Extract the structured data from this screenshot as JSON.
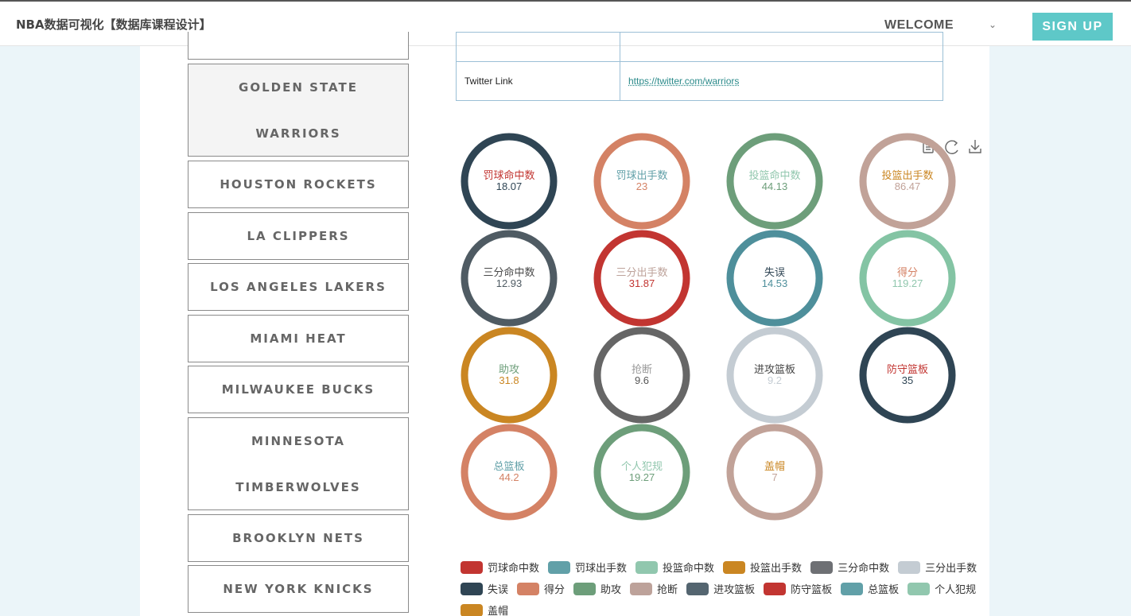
{
  "header": {
    "app_title": "NBA数据可视化【数据库课程设计】",
    "welcome_label": "WELCOME",
    "signup_label": "SIGN UP"
  },
  "teams": [
    {
      "name": "GOLDEN STATE WARRIORS",
      "active": true
    },
    {
      "name": "HOUSTON ROCKETS"
    },
    {
      "name": "LA CLIPPERS"
    },
    {
      "name": "LOS ANGELES LAKERS"
    },
    {
      "name": "MIAMI HEAT"
    },
    {
      "name": "MILWAUKEE BUCKS"
    },
    {
      "name": "MINNESOTA TIMBERWOLVES"
    },
    {
      "name": "BROOKLYN NETS"
    },
    {
      "name": "NEW YORK KNICKS"
    }
  ],
  "info": {
    "twitter_label": "Twitter Link",
    "twitter_url": "https://twitter.com/warriors"
  },
  "toolbox": [
    "data-view-icon",
    "restore-icon",
    "download-icon"
  ],
  "chart_data": {
    "type": "pie",
    "series": [
      {
        "name": "罚球命中数",
        "value": 18.07,
        "ring_color": "#2f4554",
        "name_color": "#c23531",
        "value_color": "#2f4554"
      },
      {
        "name": "罚球出手数",
        "value": 23,
        "ring_color": "#d48265",
        "name_color": "#61a0a8",
        "value_color": "#d48265"
      },
      {
        "name": "投篮命中数",
        "value": 44.13,
        "ring_color": "#6d9e7a",
        "name_color": "#91c7ae",
        "value_color": "#6d9e7a"
      },
      {
        "name": "投篮出手数",
        "value": 86.47,
        "ring_color": "#c1a298",
        "name_color": "#ca8622",
        "value_color": "#c1a298"
      },
      {
        "name": "三分命中数",
        "value": 12.93,
        "ring_color": "#4f5b63",
        "name_color": "#4a4a4a",
        "value_color": "#4f5b63"
      },
      {
        "name": "三分出手数",
        "value": 31.87,
        "ring_color": "#c23531",
        "name_color": "#bda29a",
        "value_color": "#c23531"
      },
      {
        "name": "失误",
        "value": 14.53,
        "ring_color": "#4e8f9b",
        "name_color": "#2f4554",
        "value_color": "#4e8f9b"
      },
      {
        "name": "得分",
        "value": 119.27,
        "ring_color": "#84c4a4",
        "name_color": "#d48265",
        "value_color": "#91c7ae"
      },
      {
        "name": "助攻",
        "value": 31.8,
        "ring_color": "#ca8622",
        "name_color": "#6d9e7a",
        "value_color": "#ca8622"
      },
      {
        "name": "抢断",
        "value": 9.6,
        "ring_color": "#666666",
        "name_color": "#999999",
        "value_color": "#555555"
      },
      {
        "name": "进攻篮板",
        "value": 9.2,
        "ring_color": "#c4ccd3",
        "name_color": "#444444",
        "value_color": "#c4ccd3"
      },
      {
        "name": "防守篮板",
        "value": 35,
        "ring_color": "#2f4554",
        "name_color": "#c23531",
        "value_color": "#2f4554"
      },
      {
        "name": "总篮板",
        "value": 44.2,
        "ring_color": "#d48265",
        "name_color": "#61a0a8",
        "value_color": "#d48265"
      },
      {
        "name": "个人犯规",
        "value": 19.27,
        "ring_color": "#6d9e7a",
        "name_color": "#91c7ae",
        "value_color": "#6d9e7a"
      },
      {
        "name": "盖帽",
        "value": 7,
        "ring_color": "#c1a298",
        "name_color": "#ca8622",
        "value_color": "#c1a298"
      }
    ],
    "legend": [
      {
        "name": "罚球命中数",
        "color": "#c23531"
      },
      {
        "name": "罚球出手数",
        "color": "#61a0a8"
      },
      {
        "name": "投篮命中数",
        "color": "#91c7ae"
      },
      {
        "name": "投篮出手数",
        "color": "#ca8622"
      },
      {
        "name": "三分命中数",
        "color": "#6e7074"
      },
      {
        "name": "三分出手数",
        "color": "#c4ccd3"
      },
      {
        "name": "失误",
        "color": "#2f4554"
      },
      {
        "name": "得分",
        "color": "#d48265"
      },
      {
        "name": "助攻",
        "color": "#6d9e7a"
      },
      {
        "name": "抢断",
        "color": "#bda29a"
      },
      {
        "name": "进攻篮板",
        "color": "#546570"
      },
      {
        "name": "防守篮板",
        "color": "#c23531"
      },
      {
        "name": "总篮板",
        "color": "#61a0a8"
      },
      {
        "name": "个人犯规",
        "color": "#91c7ae"
      },
      {
        "name": "盖帽",
        "color": "#ca8622"
      }
    ],
    "legend_position": "bottom"
  }
}
